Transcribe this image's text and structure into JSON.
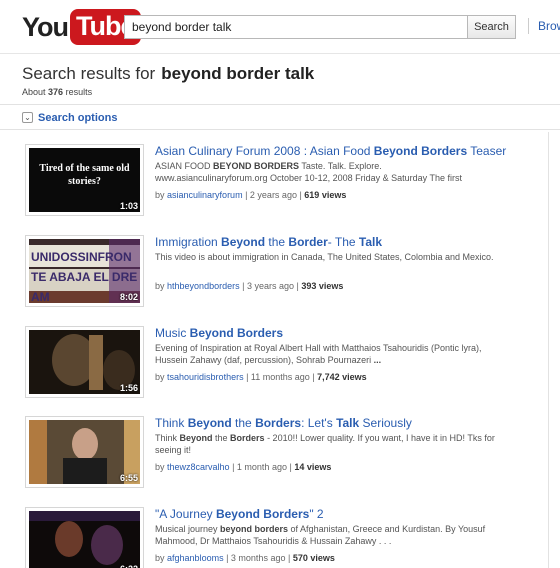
{
  "header": {
    "logo_you": "You",
    "logo_tube": "Tube",
    "search_value": "beyond border talk",
    "search_button": "Search",
    "browse_label": "Brows"
  },
  "results_header": {
    "prefix": "Search results for",
    "query": "beyond border talk",
    "count_prefix": "About",
    "count": "376",
    "count_suffix": "results"
  },
  "search_options": {
    "icon": "chevron-down-icon",
    "label": "Search options"
  },
  "results": [
    {
      "title_parts": [
        {
          "t": "Asian Culinary Forum 2008 : Asian Food ",
          "b": false
        },
        {
          "t": "Beyond Borders",
          "b": true
        },
        {
          "t": " Teaser",
          "b": false
        }
      ],
      "desc_parts": [
        {
          "t": "ASIAN FOOD ",
          "b": false
        },
        {
          "t": "BEYOND BORDERS",
          "b": true
        },
        {
          "t": " Taste. ",
          "b": false
        },
        {
          "t": "Talk",
          "b": false
        },
        {
          "t": ". Explore. www.asianculinaryforum.org October 10-12, 2008 Friday & Saturday The first",
          "b": false
        }
      ],
      "by": "by",
      "user": "asianculinaryforum",
      "age": "2 years ago",
      "views": "619 views",
      "duration": "1:03",
      "thumb_caption": "Tired of the same old stories?"
    },
    {
      "title_parts": [
        {
          "t": "Immigration ",
          "b": false
        },
        {
          "t": "Beyond",
          "b": true
        },
        {
          "t": " the ",
          "b": false
        },
        {
          "t": "Border",
          "b": true
        },
        {
          "t": "- The ",
          "b": false
        },
        {
          "t": "Talk",
          "b": true
        }
      ],
      "desc_parts": [
        {
          "t": "This video is about immigration in Canada, The United States, Colombia and Mexico.",
          "b": false
        }
      ],
      "by": "by",
      "user": "hthbeyondborders",
      "age": "3 years ago",
      "views": "393 views",
      "duration": "8:02",
      "thumb_caption": ""
    },
    {
      "title_parts": [
        {
          "t": "Music ",
          "b": false
        },
        {
          "t": "Beyond Borders",
          "b": true
        }
      ],
      "desc_parts": [
        {
          "t": "Evening of Inspiration at Royal Albert Hall with Matthaios Tsahouridis (Pontic lyra), Hussein Zahawy (daf, percussion), Sohrab Pournazeri ",
          "b": false
        },
        {
          "t": "...",
          "b": true
        }
      ],
      "by": "by",
      "user": "tsahouridisbrothers",
      "age": "11 months ago",
      "views": "7,742 views",
      "duration": "1:56",
      "thumb_caption": ""
    },
    {
      "title_parts": [
        {
          "t": "Think ",
          "b": false
        },
        {
          "t": "Beyond",
          "b": true
        },
        {
          "t": " the ",
          "b": false
        },
        {
          "t": "Borders",
          "b": true
        },
        {
          "t": ": Let's ",
          "b": false
        },
        {
          "t": "Talk",
          "b": true
        },
        {
          "t": " Seriously",
          "b": false
        }
      ],
      "desc_parts": [
        {
          "t": "Think ",
          "b": false
        },
        {
          "t": "Beyond",
          "b": true
        },
        {
          "t": " the ",
          "b": false
        },
        {
          "t": "Borders",
          "b": true
        },
        {
          "t": " - 2010!! Lower quality. If you want, I have it in HD! Tks for seeing it!",
          "b": false
        }
      ],
      "by": "by",
      "user": "thewz8carvalho",
      "age": "1 month ago",
      "views": "14 views",
      "duration": "6:55",
      "thumb_caption": ""
    },
    {
      "title_parts": [
        {
          "t": "\"A Journey ",
          "b": false
        },
        {
          "t": "Beyond Borders",
          "b": true
        },
        {
          "t": "\" 2",
          "b": false
        }
      ],
      "desc_parts": [
        {
          "t": "Musical journey ",
          "b": false
        },
        {
          "t": "beyond borders",
          "b": true
        },
        {
          "t": " of Afghanistan, Greece and Kurdistan. By Yousuf Mahmood, Dr Matthaios Tsahouridis & Hussain Zahawy . . .",
          "b": false
        }
      ],
      "by": "by",
      "user": "afghanblooms",
      "age": "3 months ago",
      "views": "570 views",
      "duration": "6:22",
      "thumb_caption": ""
    }
  ],
  "thumb_sign_text": "UNIDOSSINFRONTE ABAJA EL DREAM"
}
